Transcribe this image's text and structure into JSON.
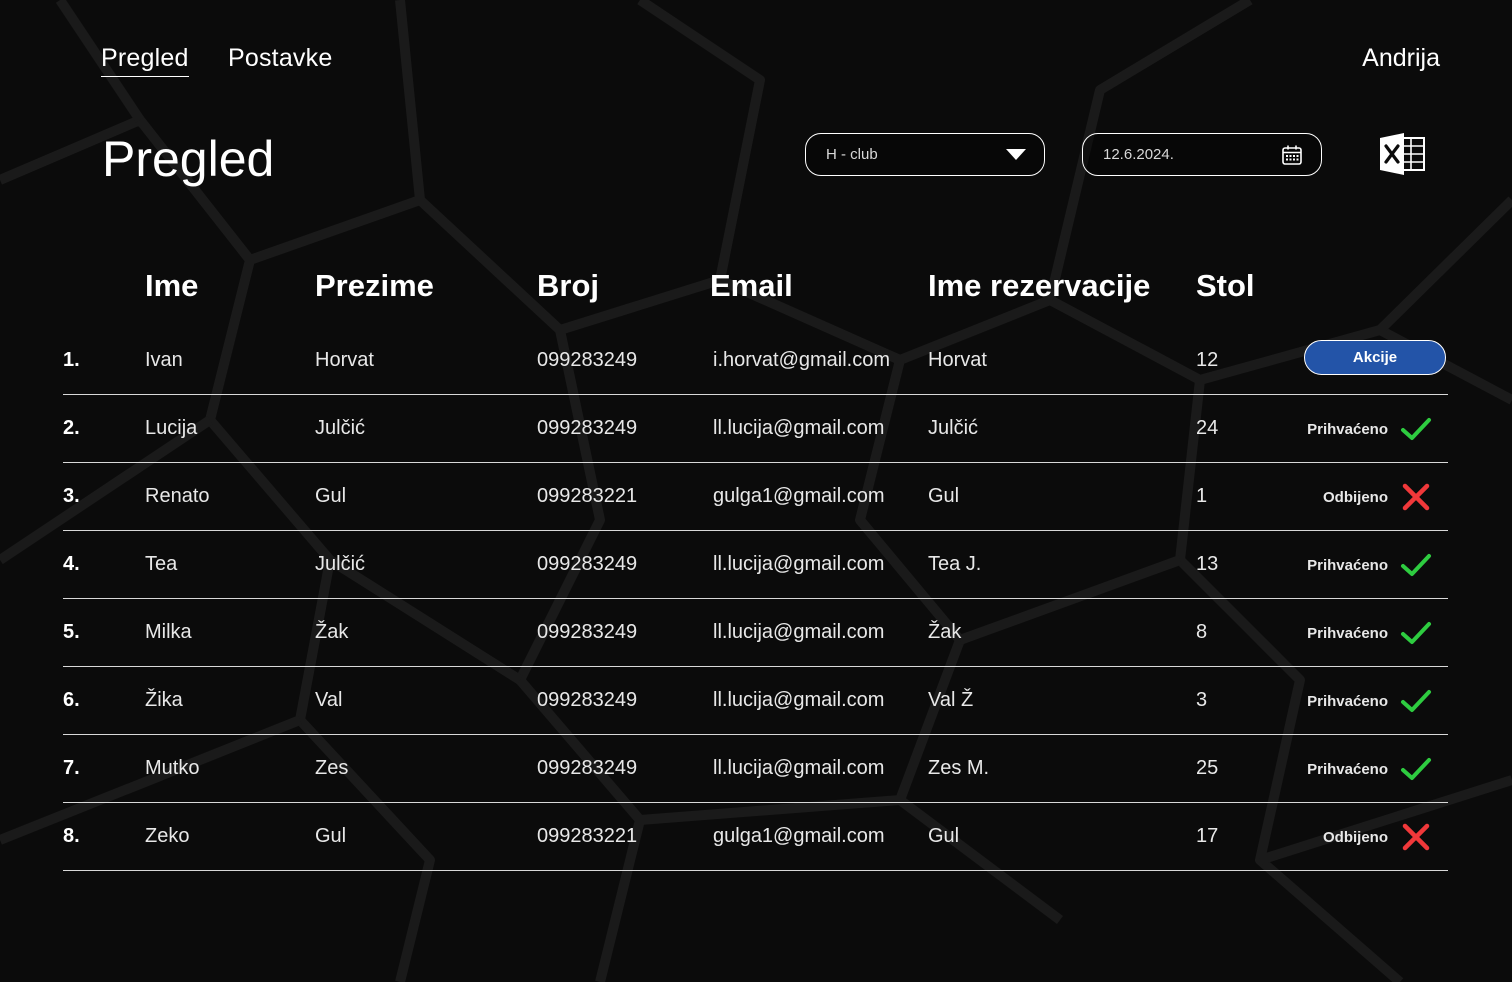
{
  "nav": {
    "items": [
      {
        "label": "Pregled",
        "active": true
      },
      {
        "label": "Postavke",
        "active": false
      }
    ],
    "user": "Andrija"
  },
  "page": {
    "title": "Pregled"
  },
  "filters": {
    "venue": {
      "value": "H - club",
      "icon": "caret-down-icon"
    },
    "date": {
      "value": "12.6.2024.",
      "icon": "calendar-icon"
    },
    "export_icon": "excel-icon"
  },
  "table": {
    "headers": [
      "Ime",
      "Prezime",
      "Broj",
      "Email",
      "Ime rezervacije",
      "Stol"
    ],
    "rows": [
      {
        "index": "1.",
        "ime": "Ivan",
        "prezime": "Horvat",
        "broj": "099283249",
        "email": "i.horvat@gmail.com",
        "rezervacija": "Horvat",
        "stol": "12",
        "status": "action",
        "action_label": "Akcije"
      },
      {
        "index": "2.",
        "ime": "Lucija",
        "prezime": "Julčić",
        "broj": "099283249",
        "email": "ll.lucija@gmail.com",
        "rezervacija": "Julčić",
        "stol": "24",
        "status": "accepted",
        "status_label": "Prihvaćeno"
      },
      {
        "index": "3.",
        "ime": "Renato",
        "prezime": "Gul",
        "broj": "099283221",
        "email": "gulga1@gmail.com",
        "rezervacija": "Gul",
        "stol": "1",
        "status": "rejected",
        "status_label": "Odbijeno"
      },
      {
        "index": "4.",
        "ime": "Tea",
        "prezime": "Julčić",
        "broj": "099283249",
        "email": "ll.lucija@gmail.com",
        "rezervacija": "Tea J.",
        "stol": "13",
        "status": "accepted",
        "status_label": "Prihvaćeno"
      },
      {
        "index": "5.",
        "ime": "Milka",
        "prezime": "Žak",
        "broj": "099283249",
        "email": "ll.lucija@gmail.com",
        "rezervacija": "Žak",
        "stol": "8",
        "status": "accepted",
        "status_label": "Prihvaćeno"
      },
      {
        "index": "6.",
        "ime": "Žika",
        "prezime": "Val",
        "broj": "099283249",
        "email": "ll.lucija@gmail.com",
        "rezervacija": "Val Ž",
        "stol": "3",
        "status": "accepted",
        "status_label": "Prihvaćeno"
      },
      {
        "index": "7.",
        "ime": "Mutko",
        "prezime": "Zes",
        "broj": "099283249",
        "email": "ll.lucija@gmail.com",
        "rezervacija": "Zes M.",
        "stol": "25",
        "status": "accepted",
        "status_label": "Prihvaćeno"
      },
      {
        "index": "8.",
        "ime": "Zeko",
        "prezime": "Gul",
        "broj": "099283221",
        "email": "gulga1@gmail.com",
        "rezervacija": "Gul",
        "stol": "17",
        "status": "rejected",
        "status_label": "Odbijeno"
      }
    ]
  },
  "colors": {
    "background": "#0b0b0b",
    "accent_button": "#2354a8",
    "accepted": "#2ecc40",
    "rejected": "#f0383a",
    "divider": "#d9d9d9"
  }
}
